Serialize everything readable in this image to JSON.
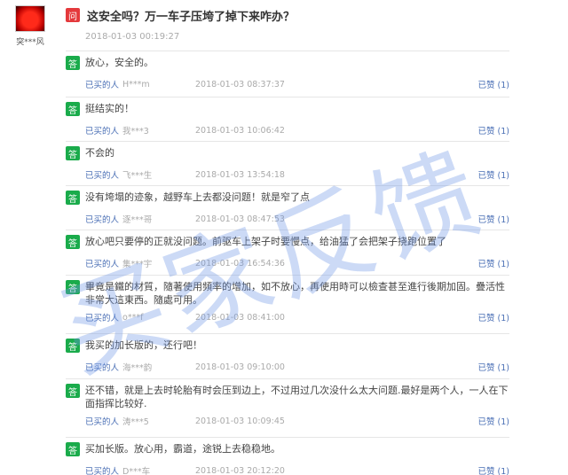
{
  "asker": {
    "name": "突***风"
  },
  "question": {
    "badge": "问",
    "text": "这安全吗？万一车子压垮了掉下来咋办？",
    "time": "2018-01-03 00:19:27"
  },
  "answers": [
    {
      "badge": "答",
      "text": "放心，安全的。",
      "buyer_label": "已买的人",
      "user": "H***m",
      "time": "2018-01-03 08:37:37",
      "like": "已赞 (1)"
    },
    {
      "badge": "答",
      "text": "挺结实的！",
      "buyer_label": "已买的人",
      "user": "我***3",
      "time": "2018-01-03 10:06:42",
      "like": "已赞 (1)"
    },
    {
      "badge": "答",
      "text": "不会的",
      "buyer_label": "已买的人",
      "user": "飞***生",
      "time": "2018-01-03 13:54:18",
      "like": "已赞 (1)"
    },
    {
      "badge": "答",
      "text": "没有垮塌的迹象，越野车上去都没问题！就是窄了点",
      "buyer_label": "已买的人",
      "user": "逐***哥",
      "time": "2018-01-03 08:47:53",
      "like": "已赞 (1)"
    },
    {
      "badge": "答",
      "text": "放心吧只要停的正就没问题。前驱车上架子时要慢点，给油猛了会把架子挠跑位置了",
      "buyer_label": "已买的人",
      "user": "集***宇",
      "time": "2018-01-03 16:54:36",
      "like": "已赞 (1)"
    },
    {
      "badge": "答",
      "text": "畢竟是鐵的材質，隨著使用頻率的增加，如不放心，再使用時可以檢查甚至進行後期加固。疊活性非常大這東西。隨處可用。",
      "buyer_label": "已买的人",
      "user": "o***f",
      "time": "2018-01-03 08:41:00",
      "like": "已赞 (1)"
    },
    {
      "badge": "答",
      "text": "我买的加长版的，还行吧！",
      "buyer_label": "已买的人",
      "user": "海***韵",
      "time": "2018-01-03 09:10:00",
      "like": "已赞 (1)"
    },
    {
      "badge": "答",
      "text": "还不错，就是上去时轮胎有时会压到边上，不过用过几次没什么太大问题.最好是两个人，一人在下面指挥比较好.",
      "buyer_label": "已买的人",
      "user": "涛***5",
      "time": "2018-01-03 10:09:45",
      "like": "已赞 (1)"
    },
    {
      "badge": "答",
      "text": "买加长版。放心用，霸道，途锐上去稳稳地。",
      "buyer_label": "已买的人",
      "user": "D***车",
      "time": "2018-01-03 20:12:20",
      "like": "已赞 (1)"
    }
  ],
  "watermark": "买家反馈"
}
